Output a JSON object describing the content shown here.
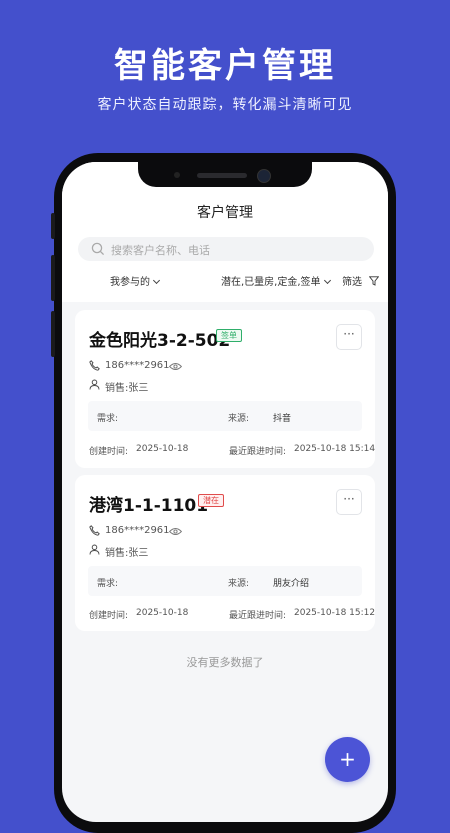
{
  "promo": {
    "title": "智能客户管理",
    "subtitle": "客户状态自动跟踪，转化漏斗清晰可见"
  },
  "app": {
    "nav_title": "客户管理",
    "search_placeholder": "搜索客户名称、电话",
    "filters": {
      "participation": "我参与的",
      "status": "潜在,已量房,定金,签单",
      "filter_label": "筛选"
    },
    "customers": [
      {
        "name": "金色阳光3-2-502",
        "tag": "签单",
        "phone": "186****2961",
        "sales": "销售:张三",
        "need_label": "需求:",
        "need_value": "",
        "source_label": "来源:",
        "source_value": "抖音",
        "created_label": "创建时间:",
        "created_value": "2025-10-18",
        "followup_label": "最近跟进时间:",
        "followup_value": "2025-10-18 15:14"
      },
      {
        "name": "港湾1-1-1101",
        "tag": "潜在",
        "phone": "186****2961",
        "sales": "销售:张三",
        "need_label": "需求:",
        "need_value": "",
        "source_label": "来源:",
        "source_value": "朋友介绍",
        "created_label": "创建时间:",
        "created_value": "2025-10-18",
        "followup_label": "最近跟进时间:",
        "followup_value": "2025-10-18 15:12"
      }
    ],
    "no_more_text": "没有更多数据了",
    "fab_label": "+",
    "more_label": "···"
  },
  "colors": {
    "background": "#4450cc",
    "accent": "#4c54d6",
    "tag_signed": "#2fae6a",
    "tag_potential": "#e04b4b"
  },
  "icons": [
    "search-icon",
    "chevron-down-icon",
    "filter-icon",
    "phone-icon",
    "eye-icon",
    "user-icon",
    "more-icon",
    "plus-icon"
  ]
}
